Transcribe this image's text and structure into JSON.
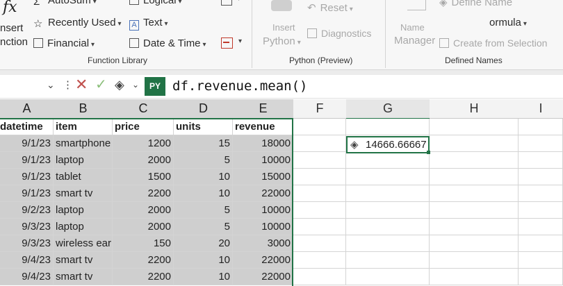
{
  "ribbon": {
    "insert_function": {
      "line1": "nsert",
      "line2": "nction"
    },
    "function_library": {
      "autosum": "AutoSum",
      "recently_used": "Recently Used",
      "financial": "Financial",
      "logical": "Logical",
      "text": "Text",
      "date_time": "Date & Time",
      "group_label": "Function Library"
    },
    "python": {
      "reset": "Reset",
      "insert_python": "Insert",
      "python_label": "Python",
      "diagnostics": "Diagnostics",
      "group_label": "Python (Preview)"
    },
    "defined_names": {
      "define_name": "Define Name",
      "formula": "ormula",
      "name_manager_1": "Name",
      "name_manager_2": "Manager",
      "create_from_selection": "Create from Selection",
      "group_label": "Defined Names"
    }
  },
  "formula_bar": {
    "py_badge": "PY",
    "formula": "df.revenue.mean()"
  },
  "columns": [
    "A",
    "B",
    "C",
    "D",
    "E",
    "F",
    "G",
    "H",
    "I"
  ],
  "header_row": [
    "datetime",
    "item",
    "price",
    "units",
    "revenue"
  ],
  "rows": [
    [
      "9/1/23",
      "smartphone",
      "1200",
      "15",
      "18000"
    ],
    [
      "9/1/23",
      "laptop",
      "2000",
      "5",
      "10000"
    ],
    [
      "9/1/23",
      "tablet",
      "1500",
      "10",
      "15000"
    ],
    [
      "9/1/23",
      "smart tv",
      "2200",
      "10",
      "22000"
    ],
    [
      "9/2/23",
      "laptop",
      "2000",
      "5",
      "10000"
    ],
    [
      "9/3/23",
      "laptop",
      "2000",
      "5",
      "10000"
    ],
    [
      "9/3/23",
      "wireless earb",
      "150",
      "20",
      "3000"
    ],
    [
      "9/4/23",
      "smart tv",
      "2200",
      "10",
      "22000"
    ],
    [
      "9/4/23",
      "smart tv",
      "2200",
      "10",
      "22000"
    ]
  ],
  "result_cell": {
    "value": "14666.66667"
  },
  "colors": {
    "accent": "#217346",
    "selection_shade": "#cfcfcf"
  }
}
